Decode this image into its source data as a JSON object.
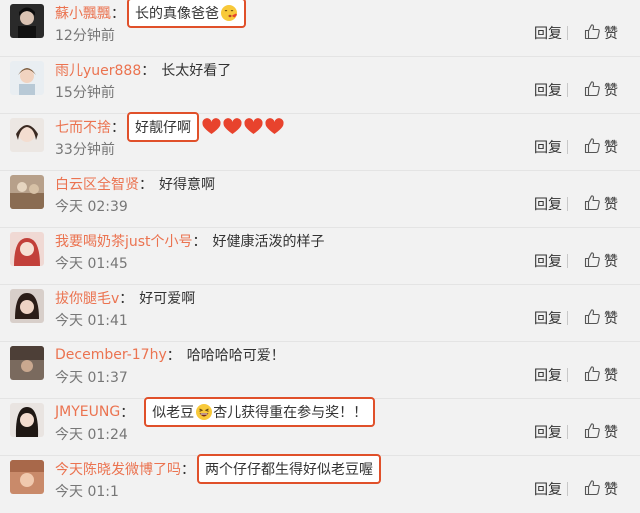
{
  "actions": {
    "reply_label": "回复",
    "like_label": "赞"
  },
  "colors": {
    "username": "#eb7350",
    "highlight_border": "#e0502a",
    "heart": "#e8432d"
  },
  "comments": [
    {
      "user": "蘇小飄飄",
      "text": "长的真像爸爸",
      "time": "12分钟前",
      "emoji": "kissing-face"
    },
    {
      "user": "雨儿yuer888",
      "text": "长太好看了",
      "time": "15分钟前"
    },
    {
      "user": "七而不捨",
      "text": "好靓仔啊",
      "time": "33分钟前",
      "emoji": "hearts-x4"
    },
    {
      "user": "白云区全智贤",
      "text": "好得意啊",
      "time": "今天 02:39"
    },
    {
      "user": "我要喝奶茶just个小号",
      "text": "好健康活泼的样子",
      "time": "今天 01:45"
    },
    {
      "user": "拔你腿毛v",
      "text": "好可爱啊",
      "time": "今天 01:41"
    },
    {
      "user": "December-17hy",
      "text": "哈哈哈哈可爱！",
      "time": "今天 01:37"
    },
    {
      "user": "JMYEUNG",
      "text_before": "似老豆",
      "text_after": "杏儿获得重在参与奖！！",
      "time": "今天 01:24",
      "emoji": "grinning-squint-face"
    },
    {
      "user": "今天陈晓发微博了吗",
      "text": "两个仔仔都生得好似老豆喔",
      "time": "今天 01:1"
    }
  ]
}
